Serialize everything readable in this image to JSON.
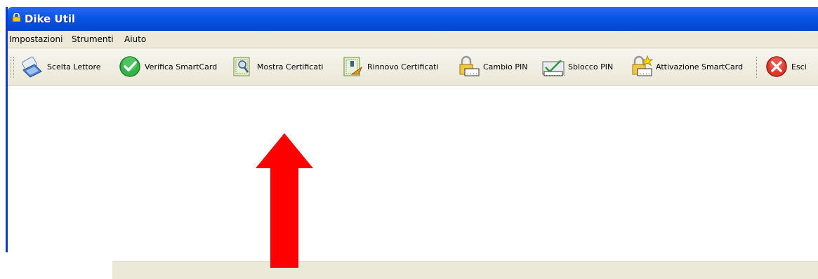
{
  "window": {
    "title": "Dike Util"
  },
  "menu": [
    "Impostazioni",
    "Strumenti",
    "Aiuto"
  ],
  "toolbar": {
    "scelta_lettore": "Scelta Lettore",
    "verifica_smartcard": "Verifica SmartCard",
    "mostra_certificati": "Mostra Certificati",
    "rinnovo_certificati": "Rinnovo Certificati",
    "cambio_pin": "Cambio PIN",
    "sblocco_pin": "Sblocco PIN",
    "attivazione_smartcard": "Attivazione SmartCard",
    "esci": "Esci"
  },
  "icons": {
    "scelta_lettore": "card-reader-icon",
    "verifica_smartcard": "green-check-icon",
    "mostra_certificati": "certificate-magnifier-icon",
    "rinnovo_certificati": "certificate-renew-icon",
    "cambio_pin": "pin-lock-icon",
    "sblocco_pin": "pin-unlock-icon",
    "attivazione_smartcard": "pin-activate-icon",
    "esci": "exit-icon"
  },
  "colors": {
    "titlebar": "#0a57e8",
    "arrow": "#ff0000",
    "chrome": "#ece9d8"
  }
}
